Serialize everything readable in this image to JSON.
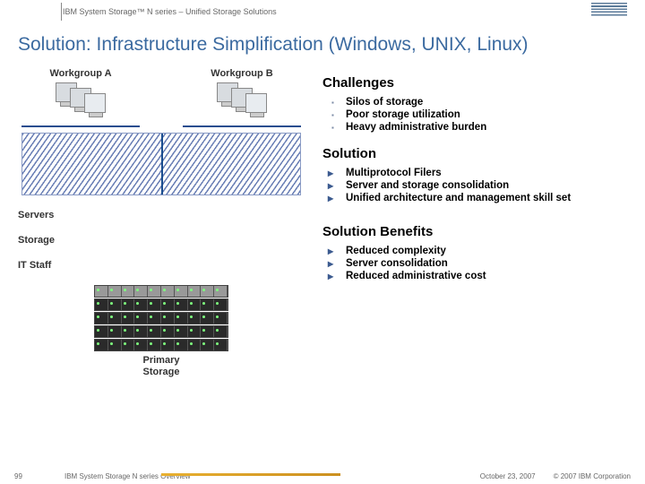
{
  "header": {
    "subtitle": "IBM System Storage™ N series – Unified Storage Solutions"
  },
  "title": "Solution: Infrastructure Simplification (Windows, UNIX, Linux)",
  "diagram": {
    "workgroup_a": "Workgroup A",
    "workgroup_b": "Workgroup B",
    "servers_label": "Servers",
    "storage_label": "Storage",
    "itstaff_label": "IT Staff",
    "primary_storage_l1": "Primary",
    "primary_storage_l2": "Storage"
  },
  "challenges": {
    "heading": "Challenges",
    "items": [
      "Silos of storage",
      "Poor storage utilization",
      "Heavy administrative burden"
    ]
  },
  "solution": {
    "heading": "Solution",
    "items": [
      "Multiprotocol Filers",
      "Server and storage consolidation",
      "Unified architecture and management skill set"
    ]
  },
  "benefits": {
    "heading": "Solution Benefits",
    "items": [
      "Reduced complexity",
      "Server consolidation",
      "Reduced administrative cost"
    ]
  },
  "footer": {
    "page": "99",
    "title": "IBM System Storage N series Overview",
    "date": "October 23, 2007",
    "copyright": "© 2007 IBM Corporation"
  }
}
